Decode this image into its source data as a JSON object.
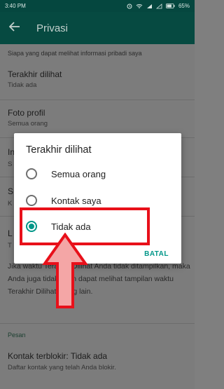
{
  "status_bar": {
    "time": "3:40 PM",
    "battery": "65%"
  },
  "app_bar": {
    "title": "Privasi"
  },
  "settings": {
    "section_header": "Siapa yang dapat melihat informasi pribadi saya",
    "last_seen": {
      "title": "Terakhir dilihat",
      "value": "Tidak ada"
    },
    "profile_photo": {
      "title": "Foto profil",
      "value": "Semua orang"
    },
    "hidden_row_1": {
      "title": "In",
      "value": "S"
    },
    "hidden_row_2": {
      "title": "S",
      "value": "K"
    },
    "hidden_row_3": {
      "title": "L",
      "value": "T"
    },
    "info_paragraph": "Jika waktu Terakhir Dilihat Anda tidak ditampilkan, maka Anda juga tidak akan dapat melihat tampilan waktu Terakhir Dilihat orang lain.",
    "messages_header": "Pesan",
    "blocked": {
      "title": "Kontak terblokir: Tidak ada",
      "subtitle": "Daftar kontak yang telah Anda blokir."
    }
  },
  "dialog": {
    "title": "Terakhir dilihat",
    "options": [
      {
        "label": "Semua orang",
        "selected": false
      },
      {
        "label": "Kontak saya",
        "selected": false
      },
      {
        "label": "Tidak ada",
        "selected": true
      }
    ],
    "cancel_label": "BATAL"
  },
  "colors": {
    "accent": "#009688",
    "app_bar": "#064a41",
    "annotation": "#e8101a"
  }
}
